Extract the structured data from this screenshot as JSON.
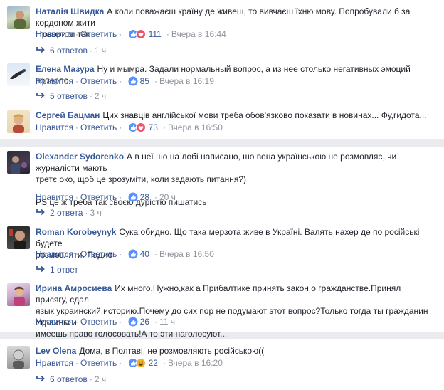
{
  "colors": {
    "name": "#365899",
    "link": "#385898",
    "muted": "#90949c",
    "like": "#5890ff",
    "love": "#f25268",
    "haha": "#f7b125"
  },
  "comments": [
    {
      "author": "Наталія Швидка",
      "lines": [
        "А коли поважаєш країну де живеш, то вивчаєш їхню мову. Попробували б за кордоном жити",
        "і говорити так"
      ],
      "like": "Нравится",
      "reply": "Ответить",
      "reactions": [
        "like",
        "love"
      ],
      "count": "111",
      "time": "Вчера в 16:44",
      "replies": {
        "count": "6 ответов",
        "time": "1 ч"
      }
    },
    {
      "author": "Елена Мазура",
      "lines": [
        "Ну и мымра. Задали нормальный вопрос, а из нее столько негативных эмоций поперло."
      ],
      "like": "Нравится",
      "reply": "Ответить",
      "reactions": [
        "like"
      ],
      "count": "85",
      "time": "Вчера в 16:19",
      "replies": {
        "count": "5 ответов",
        "time": "2 ч"
      }
    },
    {
      "author": "Сергей Бацман",
      "lines": [
        "Цих знавців англійської мови треба обов'язково показати в новинах... Фу,гидота..."
      ],
      "like": "Нравится",
      "reply": "Ответить",
      "reactions": [
        "like",
        "love"
      ],
      "count": "73",
      "time": "Вчера в 16:50"
    },
    {
      "author": "Olexander Sydorenko",
      "lines": [
        "А в неї шо на лобі написано, шо вона українською не розмовляє, чи журналісти мають",
        "третє око, щоб це зрозуміти, коли задають питання?)",
        "",
        "PS це ж треба так своєю дурістю пишатись"
      ],
      "like": "Нравится",
      "reply": "Ответить",
      "reactions": [
        "like"
      ],
      "count": "28",
      "time": "20 ч",
      "replies": {
        "count": "2 ответа",
        "time": "3 ч"
      }
    },
    {
      "author": "Roman Korobeynyk",
      "lines": [
        "Сука обидно. Що така мерзота живе в Україні. Валять нахер де по російські будете",
        "розмовляти. Падло"
      ],
      "like": "Нравится",
      "reply": "Ответить",
      "reactions": [
        "like"
      ],
      "count": "40",
      "time": "Вчера в 16:50",
      "replies": {
        "count": "1 ответ",
        "time": ""
      }
    },
    {
      "author": "Ирина Амросиева",
      "lines": [
        "Их много.Нужно,как а Прибалтике принять закон о гражданстве.Принял присягу, сдал",
        "язык украинский,историю.Почему до сих пор не подумают этот вопрос?Только тогда ты гражданин Украины и",
        "имеешь право голосовать!А то эти наголосуют..."
      ],
      "like": "Нравится",
      "reply": "Ответить",
      "reactions": [
        "like"
      ],
      "count": "26",
      "time": "11 ч"
    },
    {
      "author": "Lev Olena",
      "lines": [
        "Дома, в Полтаві, не розмовляють російською(("
      ],
      "like": "Нравится",
      "reply": "Ответить",
      "reactions": [
        "like",
        "haha"
      ],
      "count": "22",
      "time": "Вчера в 16:20",
      "replies": {
        "count": "6 ответов",
        "time": "2 ч"
      }
    }
  ]
}
